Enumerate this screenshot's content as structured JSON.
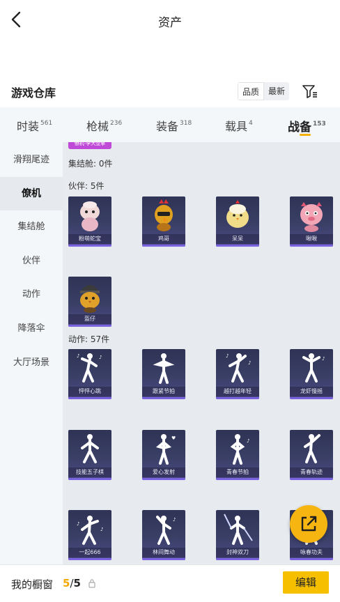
{
  "header": {
    "title": "资产"
  },
  "section": {
    "title": "游戏仓库",
    "sort_options": [
      "品质",
      "最新"
    ]
  },
  "tabs": [
    {
      "label": "时装",
      "count": "561"
    },
    {
      "label": "枪械",
      "count": "236"
    },
    {
      "label": "装备",
      "count": "318"
    },
    {
      "label": "载具",
      "count": "4"
    },
    {
      "label": "战备",
      "count": "153",
      "active": true
    }
  ],
  "sidebar": {
    "items": [
      "滑翔尾迹",
      "僚机",
      "集结舱",
      "伙伴",
      "动作",
      "降落伞",
      "大厅场景"
    ],
    "active_index": 1
  },
  "content": {
    "top_tag": "僚机-李大壶擎",
    "groups": {
      "pod_label": "集结舱: 0件",
      "partner_label": "伙伴: 5件",
      "action_label": "动作: 57件"
    },
    "partners": [
      "粉萌蛇宝",
      "鸡哥",
      "呆呆",
      "啾啾",
      "盔仔"
    ],
    "actions": [
      "怦怦心跳",
      "跟紧节拍",
      "越打越年轻",
      "龙虾慢摇",
      "技能五子棋",
      "爱心发射",
      "青春节拍",
      "青春轨迹",
      "一起666",
      "林间舞动",
      "封神双刀",
      "咏春功夫"
    ]
  },
  "bottom": {
    "label": "我的橱窗",
    "current": "5",
    "separator": "/",
    "total": "5",
    "edit_label": "编辑"
  },
  "colors": {
    "accent": "#f6c000",
    "card_bg": "#3a3f66",
    "card_bar": "#7b63e0",
    "tag": "#c04ad8"
  }
}
